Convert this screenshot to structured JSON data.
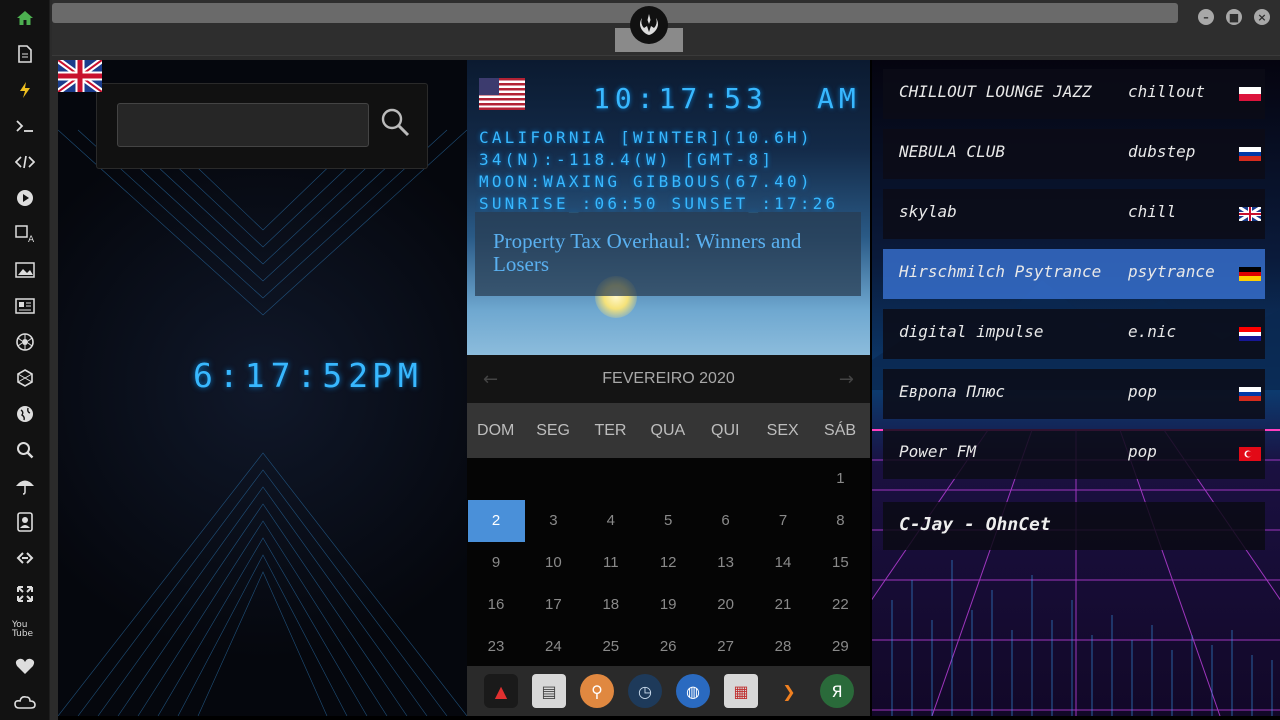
{
  "sidebar": {
    "icons": [
      "home-icon",
      "document-icon",
      "bolt-icon",
      "terminal-icon",
      "code-icon",
      "play-icon",
      "translate-icon",
      "image-icon",
      "news-icon",
      "aperture-icon",
      "hexagon-icon",
      "globe-icon",
      "search-icon",
      "umbrella-icon",
      "contacts-icon",
      "link-icon",
      "expand-icon",
      "youtube-icon",
      "heart-icon",
      "cloud-icon"
    ],
    "youtube_label": "You Tube"
  },
  "window": {
    "logo_icon": "rebel-alliance-icon",
    "buttons": [
      "minimize",
      "maximize",
      "close"
    ]
  },
  "left_panel": {
    "search": {
      "placeholder": "",
      "value": ""
    },
    "clock": {
      "country": "UK",
      "time": "6:17:52",
      "ampm": "PM"
    }
  },
  "middle_panel": {
    "clock": {
      "country": "US",
      "time": "10:17:53",
      "ampm": "AM"
    },
    "info": {
      "line1": "CALIFORNIA [WINTER](10.6H)",
      "line2": "34(N):-118.4(W) [GMT-8]",
      "line3": "MOON:WAXING GIBBOUS(67.40)",
      "line4": "SUNRISE_:06:50 SUNSET_:17:26"
    },
    "news": {
      "title": "Property Tax Overhaul: Winners and Losers"
    },
    "calendar": {
      "month": "FEVEREIRO 2020",
      "prev": "←",
      "next": "→",
      "weekdays": [
        "DOM",
        "SEG",
        "TER",
        "QUA",
        "QUI",
        "SEX",
        "SÁB"
      ],
      "weeks": [
        [
          "",
          "",
          "",
          "",
          "",
          "",
          "1"
        ],
        [
          "2",
          "3",
          "4",
          "5",
          "6",
          "7",
          "8"
        ],
        [
          "9",
          "10",
          "11",
          "12",
          "13",
          "14",
          "15"
        ],
        [
          "16",
          "17",
          "18",
          "19",
          "20",
          "21",
          "22"
        ],
        [
          "23",
          "24",
          "25",
          "26",
          "27",
          "28",
          "29"
        ]
      ],
      "selected": "2"
    },
    "dock": [
      "arch-icon",
      "news-icon",
      "search-icon",
      "clock-icon",
      "globe-icon",
      "calendar-icon",
      "arrow-icon",
      "yandex-icon"
    ],
    "dock_glyphs": [
      "▲",
      "▤",
      "⚲",
      "◷",
      "◍",
      "▦",
      "❯",
      "Я"
    ]
  },
  "right_panel": {
    "stations": [
      {
        "name": "CHILLOUT LOUNGE JAZZ",
        "genre": "chillout",
        "flag": "poland"
      },
      {
        "name": "NEBULA CLUB",
        "genre": "dubstep",
        "flag": "russia"
      },
      {
        "name": "skylab",
        "genre": "chill",
        "flag": "uk"
      },
      {
        "name": "Hirschmilch Psytrance",
        "genre": "psytrance",
        "flag": "germany"
      },
      {
        "name": "digital impulse",
        "genre": "e.nic",
        "flag": "croatia"
      },
      {
        "name": "Европа Плюс",
        "genre": "pop",
        "flag": "russia"
      },
      {
        "name": "Power FM",
        "genre": "pop",
        "flag": "turkey"
      }
    ],
    "active_index": 3,
    "now_playing": "C-Jay - OhnCet"
  }
}
